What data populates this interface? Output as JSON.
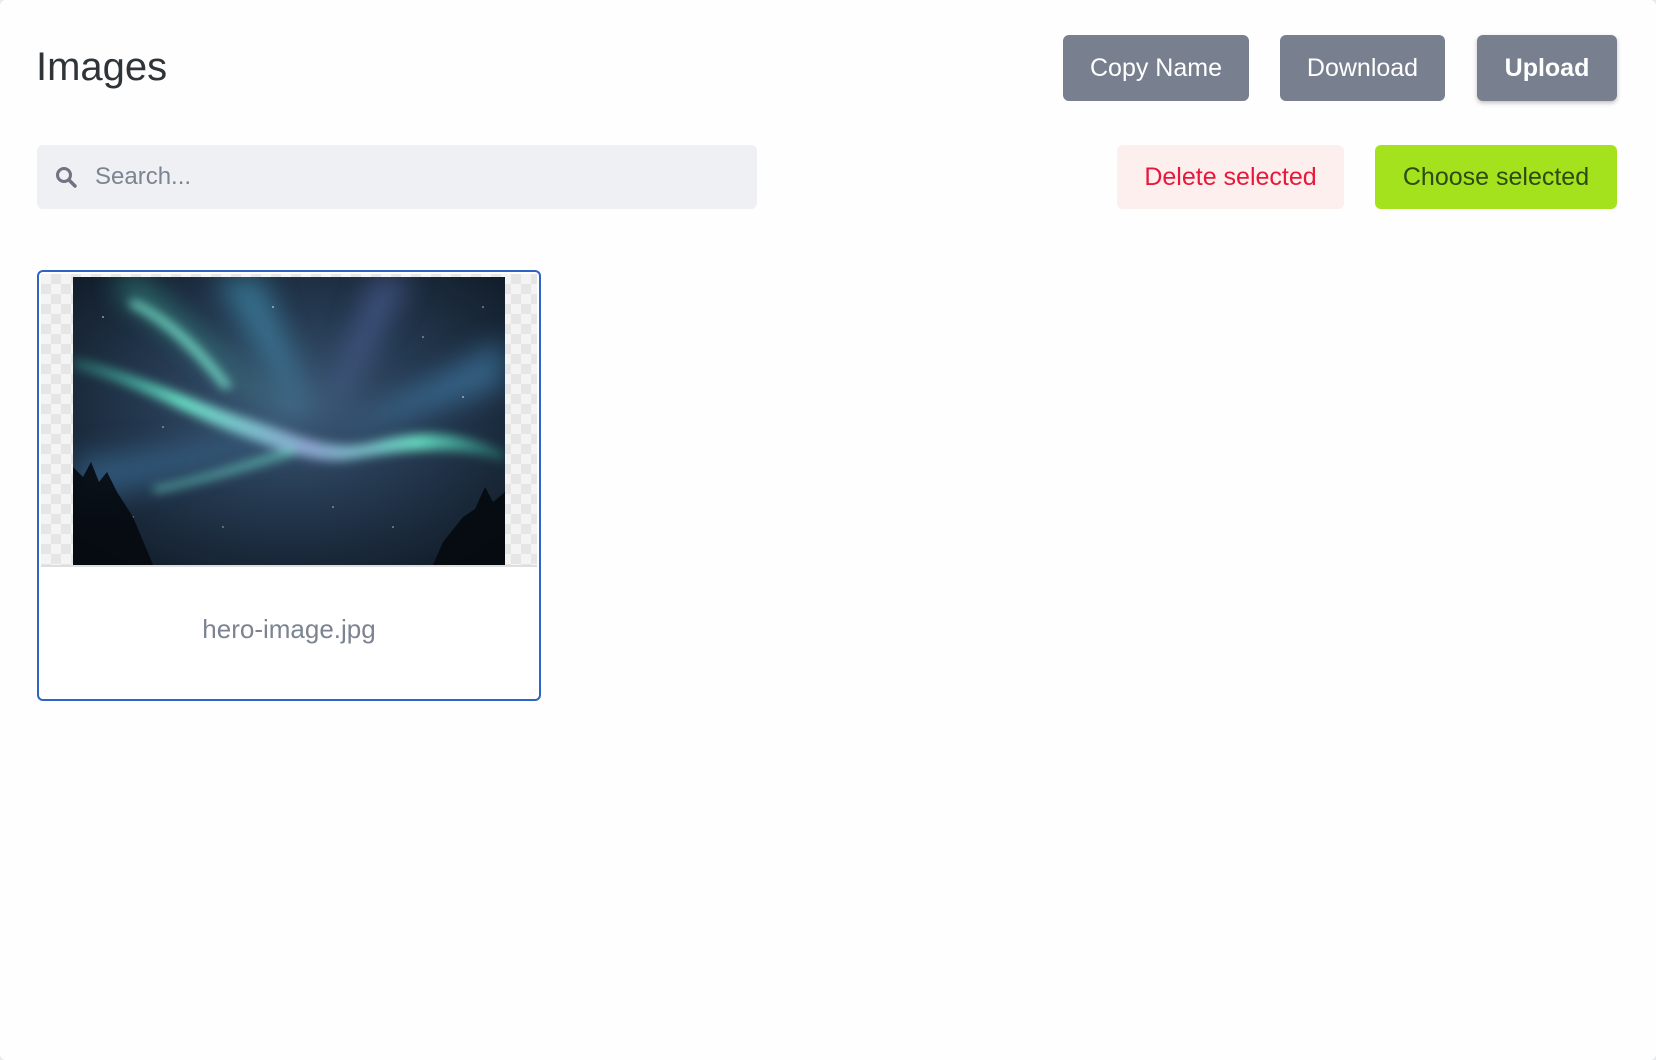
{
  "header": {
    "title": "Images",
    "copy_name_label": "Copy Name",
    "download_label": "Download",
    "upload_label": "Upload"
  },
  "toolbar": {
    "search_placeholder": "Search...",
    "search_value": "",
    "delete_selected_label": "Delete selected",
    "choose_selected_label": "Choose selected"
  },
  "images": [
    {
      "filename": "hero-image.jpg",
      "selected": true,
      "subject": "aurora over night sky"
    }
  ],
  "colors": {
    "gray_button": "#78808f",
    "delete_bg": "#fcefed",
    "delete_text": "#e8183a",
    "choose_bg": "#a3e21c",
    "choose_text": "#2e4a14",
    "selection_border": "#2f63c4"
  }
}
